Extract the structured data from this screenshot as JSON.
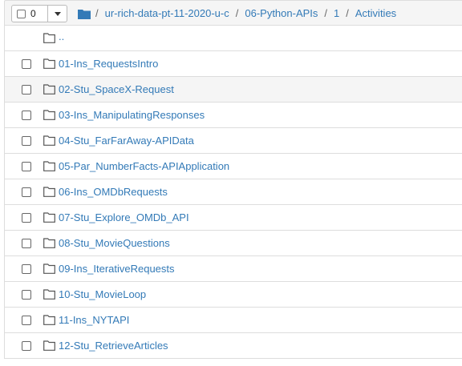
{
  "header": {
    "selected_count": "0",
    "breadcrumb": [
      "ur-rich-data-pt-11-2020-u-c",
      "06-Python-APIs",
      "1",
      "Activities"
    ],
    "separator": "/"
  },
  "parent_link": "..",
  "items": [
    {
      "name": "01-Ins_RequestsIntro",
      "highlighted": false
    },
    {
      "name": "02-Stu_SpaceX-Request",
      "highlighted": true
    },
    {
      "name": "03-Ins_ManipulatingResponses",
      "highlighted": false
    },
    {
      "name": "04-Stu_FarFarAway-APIData",
      "highlighted": false
    },
    {
      "name": "05-Par_NumberFacts-APIApplication",
      "highlighted": false
    },
    {
      "name": "06-Ins_OMDbRequests",
      "highlighted": false
    },
    {
      "name": "07-Stu_Explore_OMDb_API",
      "highlighted": false
    },
    {
      "name": "08-Stu_MovieQuestions",
      "highlighted": false
    },
    {
      "name": "09-Ins_IterativeRequests",
      "highlighted": false
    },
    {
      "name": "10-Stu_MovieLoop",
      "highlighted": false
    },
    {
      "name": "11-Ins_NYTAPI",
      "highlighted": false
    },
    {
      "name": "12-Stu_RetrieveArticles",
      "highlighted": false
    }
  ],
  "colors": {
    "link": "#337ab7",
    "header_bg": "#f5f5f5",
    "hover_bg": "#f5f5f5"
  }
}
